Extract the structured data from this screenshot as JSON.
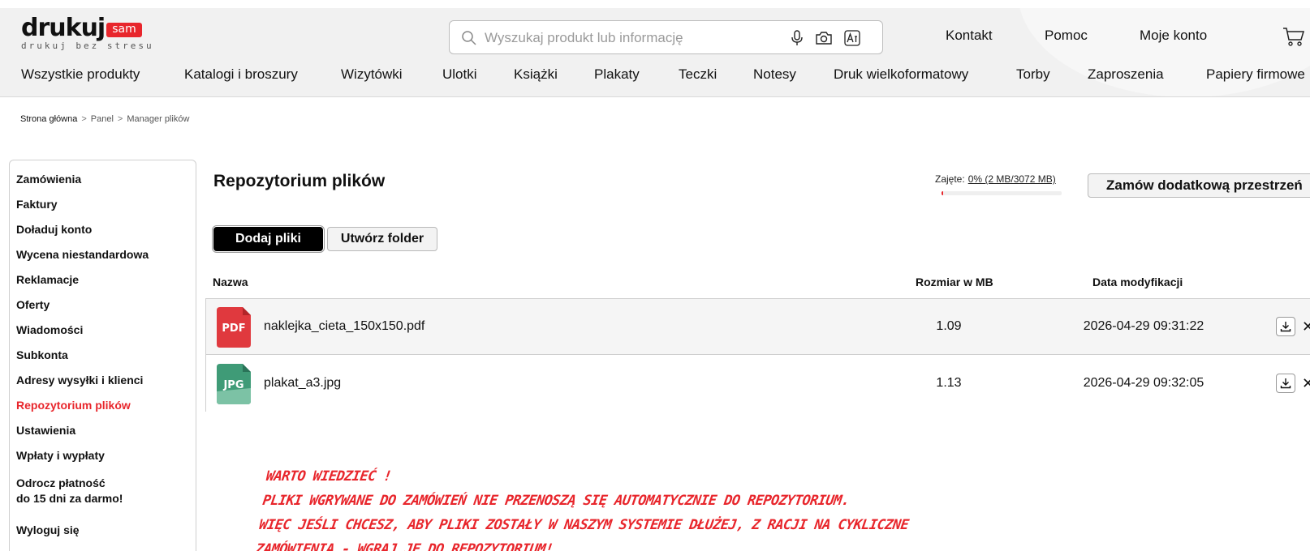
{
  "logo": {
    "word": "drukuj",
    "badge": "sam",
    "tagline": "drukuj bez stresu"
  },
  "search": {
    "placeholder": "Wyszukaj produkt lub informację"
  },
  "top_links": [
    "Kontakt",
    "Pomoc",
    "Moje konto"
  ],
  "nav": [
    "Wszystkie produkty",
    "Katalogi i broszury",
    "Wizytówki",
    "Ulotki",
    "Książki",
    "Plakaty",
    "Teczki",
    "Notesy",
    "Druk wielkoformatowy",
    "Torby",
    "Zaproszenia",
    "Papiery firmowe"
  ],
  "breadcrumb": {
    "home": "Strona główna",
    "panel": "Panel",
    "current": "Manager plików",
    "separator": ">"
  },
  "sidebar": {
    "items": [
      "Zamówienia",
      "Faktury",
      "Doładuj konto",
      "Wycena niestandardowa",
      "Reklamacje",
      "Oferty",
      "Wiadomości",
      "Subkonta",
      "Adresy wysyłki i klienci",
      "Repozytorium plików",
      "Ustawienia",
      "Wpłaty i wypłaty"
    ],
    "defer_line1": "Odrocz płatność",
    "defer_line2": "do 15 dni za darmo!",
    "logout": "Wyloguj się",
    "active_index": 9
  },
  "main": {
    "title": "Repozytorium plików",
    "usage_label": "Zajęte:",
    "usage_value": "0% (2 MB/3072 MB)",
    "usage_fraction": 0.0007,
    "order_button": "Zamów dodatkową przestrzeń",
    "add_files_button": "Dodaj pliki",
    "create_folder_button": "Utwórz folder"
  },
  "table": {
    "headers": {
      "name": "Nazwa",
      "size": "Rozmiar w MB",
      "date": "Data modyfikacji"
    },
    "rows": [
      {
        "type": "PDF",
        "name": "naklejka_cieta_150x150.pdf",
        "size": "1.09",
        "date": "2026-04-29 09:31:22"
      },
      {
        "type": "JPG",
        "name": "plakat_a3.jpg",
        "size": "1.13",
        "date": "2026-04-29 09:32:05"
      }
    ]
  },
  "note": {
    "line1": "Warto wiedzieć !",
    "line2": "Pliki wgrywane do zamówień nie przenoszą się automatycznie do repozytorium.",
    "line3": "Więc jeśli chcesz, aby pliki zostały w naszym systemie dłużej, z racji na cykliczne",
    "line4": "zamówienia - wgraj je do repozytorium!"
  },
  "colors": {
    "accent": "#e8262c",
    "pdf": "#e0393e",
    "jpg": "#3f9b77"
  },
  "icons": [
    "search-icon",
    "microphone-icon",
    "camera-icon",
    "text-recognition-icon",
    "cart-icon",
    "download-icon",
    "close-icon"
  ]
}
